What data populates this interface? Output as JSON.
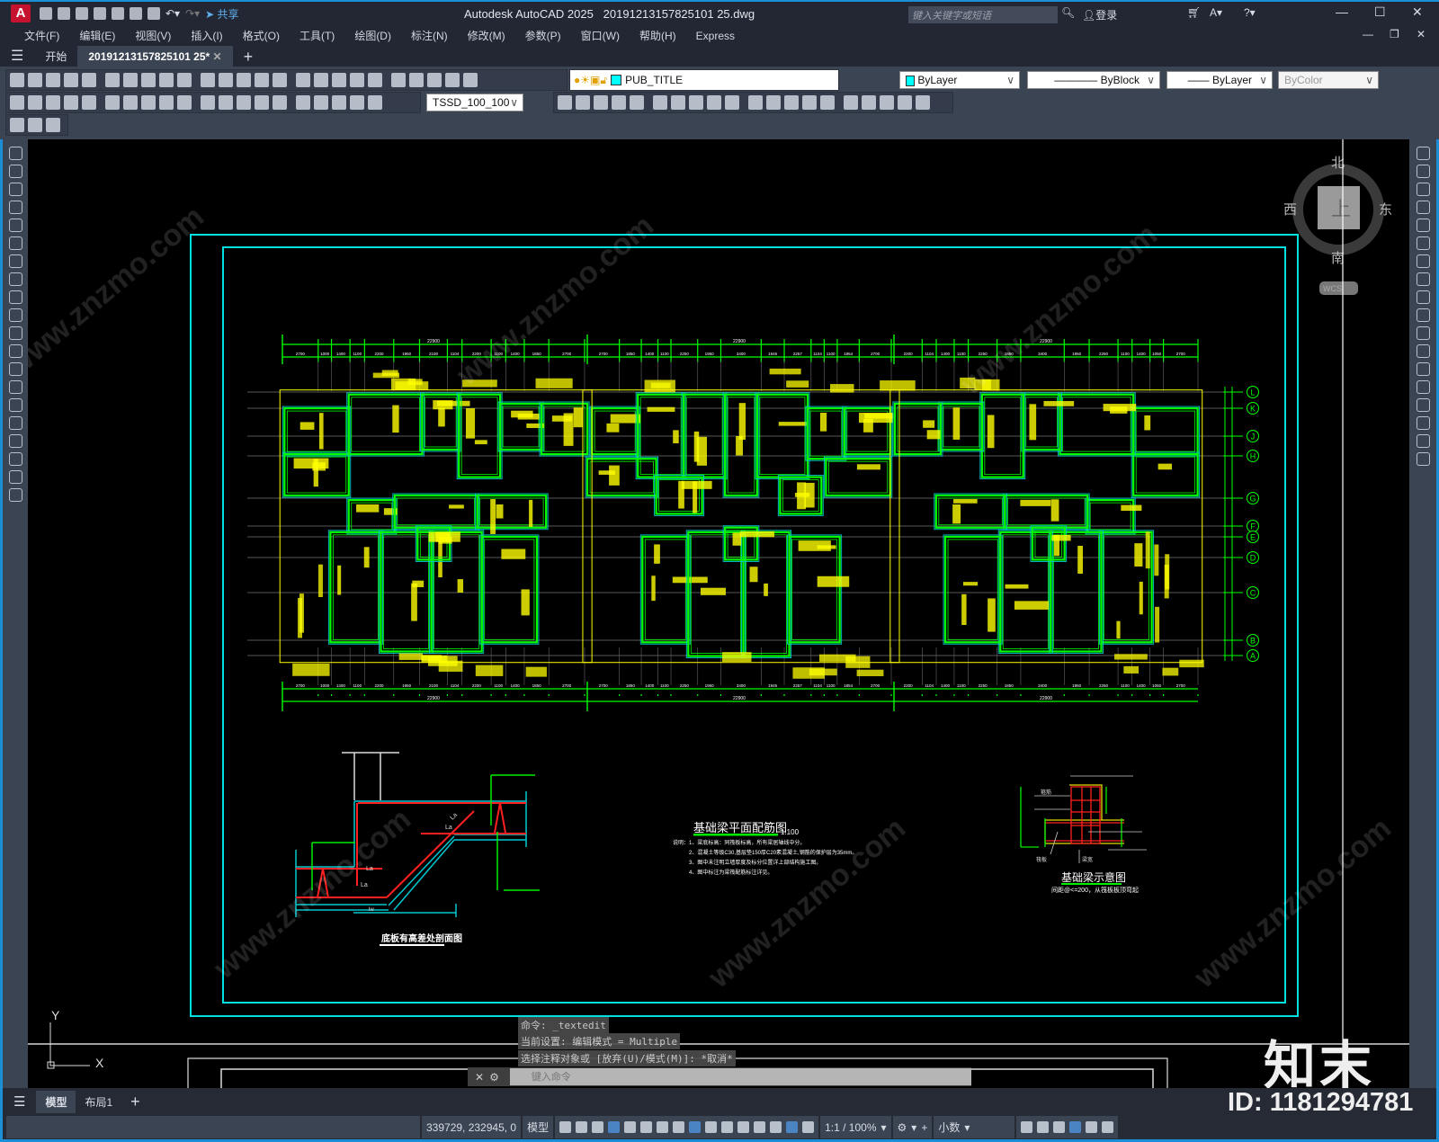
{
  "window": {
    "app_title": "Autodesk AutoCAD 2025",
    "file_name": "20191213157825101 25.dwg",
    "search_placeholder": "键入关键字或短语",
    "login": "登录",
    "share": "共享",
    "logo": "A"
  },
  "menu": [
    "文件(F)",
    "编辑(E)",
    "视图(V)",
    "插入(I)",
    "格式(O)",
    "工具(T)",
    "绘图(D)",
    "标注(N)",
    "修改(M)",
    "参数(P)",
    "窗口(W)",
    "帮助(H)",
    "Express"
  ],
  "tabs": {
    "start": "开始",
    "active": "20191213157825101 25*"
  },
  "toolbars": {
    "layer": "PUB_TITLE",
    "color": "ByLayer",
    "linetype": "ByBlock",
    "lineweight": "ByLayer",
    "plotstyle": "ByColor",
    "dimstyle": "TSSD_100_100",
    "row1_icons": [
      "new",
      "open",
      "save",
      "print",
      "print-preview",
      "publish",
      "dwf",
      "cut",
      "copy",
      "paste",
      "match-properties",
      "block-editor",
      "undo",
      "redo",
      "pan",
      "zoom-realtime",
      "zoom-window",
      "zoom-previous",
      "properties",
      "design-center",
      "tool-palettes",
      "sheet-set",
      "markup",
      "calculator",
      "help"
    ],
    "row2_icons": [
      "linear-dim",
      "aligned-dim",
      "arc-length-dim",
      "ordinate-dim",
      "radius-dim",
      "jogged-dim",
      "diameter-dim",
      "angular-dim",
      "quick-dim",
      "baseline-dim",
      "continue-dim",
      "dim-space",
      "dim-break",
      "tolerance",
      "center-mark",
      "inspect",
      "jogged-linear",
      "dim-edit",
      "dim-text-edit",
      "dim-update"
    ],
    "row2b_icons": [
      "union",
      "subtract",
      "intersect",
      "extrude",
      "move-3d",
      "box",
      "interference",
      "slice",
      "section",
      "revolve",
      "loft",
      "sweep",
      "presspull",
      "shell",
      "imprint",
      "separate",
      "clean",
      "check",
      "thicken",
      "convert"
    ],
    "row3_icons": [
      "edit-text",
      "check-spelling",
      "text-style"
    ]
  },
  "left_palette": [
    "line",
    "polyline",
    "polyline-arc",
    "polygon",
    "rectangle",
    "arc",
    "circle",
    "revision-cloud",
    "spline",
    "ellipse",
    "ellipse-arc",
    "insert-block",
    "make-block",
    "point",
    "hatch",
    "gradient",
    "region",
    "table",
    "multiline-text",
    "add-selected"
  ],
  "right_palette": [
    "erase",
    "copy",
    "mirror",
    "offset",
    "array",
    "move",
    "rotate",
    "scale",
    "stretch",
    "trim",
    "extend",
    "break-at-point",
    "break",
    "join",
    "chamfer",
    "fillet",
    "blend",
    "explode"
  ],
  "viewcube": {
    "north": "北",
    "south": "南",
    "east": "东",
    "west": "西",
    "top": "上",
    "wcs": "WCS"
  },
  "ucs": {
    "x": "X",
    "y": "Y"
  },
  "drawing": {
    "plan_title": "基础梁平面配筋图",
    "plan_scale": "1:100",
    "notes": [
      "说明：1、梁底标高：同筏板标高，所有梁居轴线中分。",
      "2、混凝土等级C30,基层垫150厚C20素混凝土,钢筋的保护层为35mm。",
      "3、图中未注明立墙厚度及标分位置详上部结构施工图。",
      "4、图中标注为梁筏配筋标注详见。"
    ],
    "section_title": "底板有高差处剖面图",
    "section_labels": [
      "La",
      "La",
      "La",
      "La",
      "lw"
    ],
    "beam_detail_title": "基础梁示意图",
    "beam_detail_note": "间距@<=200，从筏板板顶弯起",
    "beam_detail_labels": [
      "梁宽",
      "筏板",
      "箍筋"
    ],
    "axes": [
      "L",
      "K",
      "J",
      "H",
      "G",
      "F",
      "E",
      "D",
      "C",
      "B",
      "A"
    ],
    "dims_overall": [
      "22900",
      "22900",
      "22900"
    ],
    "dims_top": [
      [
        "2700",
        "1000",
        "1400",
        "1100",
        "2200",
        "1950",
        "2100",
        "1104",
        "2200",
        "1100",
        "1400",
        "1850",
        "2700"
      ],
      [
        "2700",
        "1850",
        "1400",
        "1100",
        "2250",
        "1950",
        "3400",
        "1945",
        "2257",
        "1104",
        "1100",
        "1854",
        "2700"
      ],
      [
        "2200",
        "1104",
        "1400",
        "1100",
        "2250",
        "1850",
        "3400",
        "1950",
        "2250",
        "1100",
        "1400",
        "1050",
        "2700"
      ]
    ]
  },
  "command": {
    "history": [
      "命令: _textedit",
      "当前设置: 编辑模式 = Multiple",
      "选择注释对象或 [放弃(U)/模式(M)]: *取消*"
    ],
    "placeholder": "键入命令"
  },
  "layout_tabs": [
    "模型",
    "布局1"
  ],
  "status": {
    "coords": "339729, 232945, 0",
    "model": "模型",
    "scale": "1:1 / 100%",
    "units": "小数"
  },
  "watermark": {
    "brand": "知末",
    "id": "ID: 1181294781",
    "site": "www.znzmo.com"
  },
  "colors": {
    "wall": "#00ff00",
    "outline": "#00c8d0",
    "text": "#ffff00",
    "rebar": "#ff2020",
    "frame": "#00e0e0",
    "accent": "#1b8fd6"
  }
}
